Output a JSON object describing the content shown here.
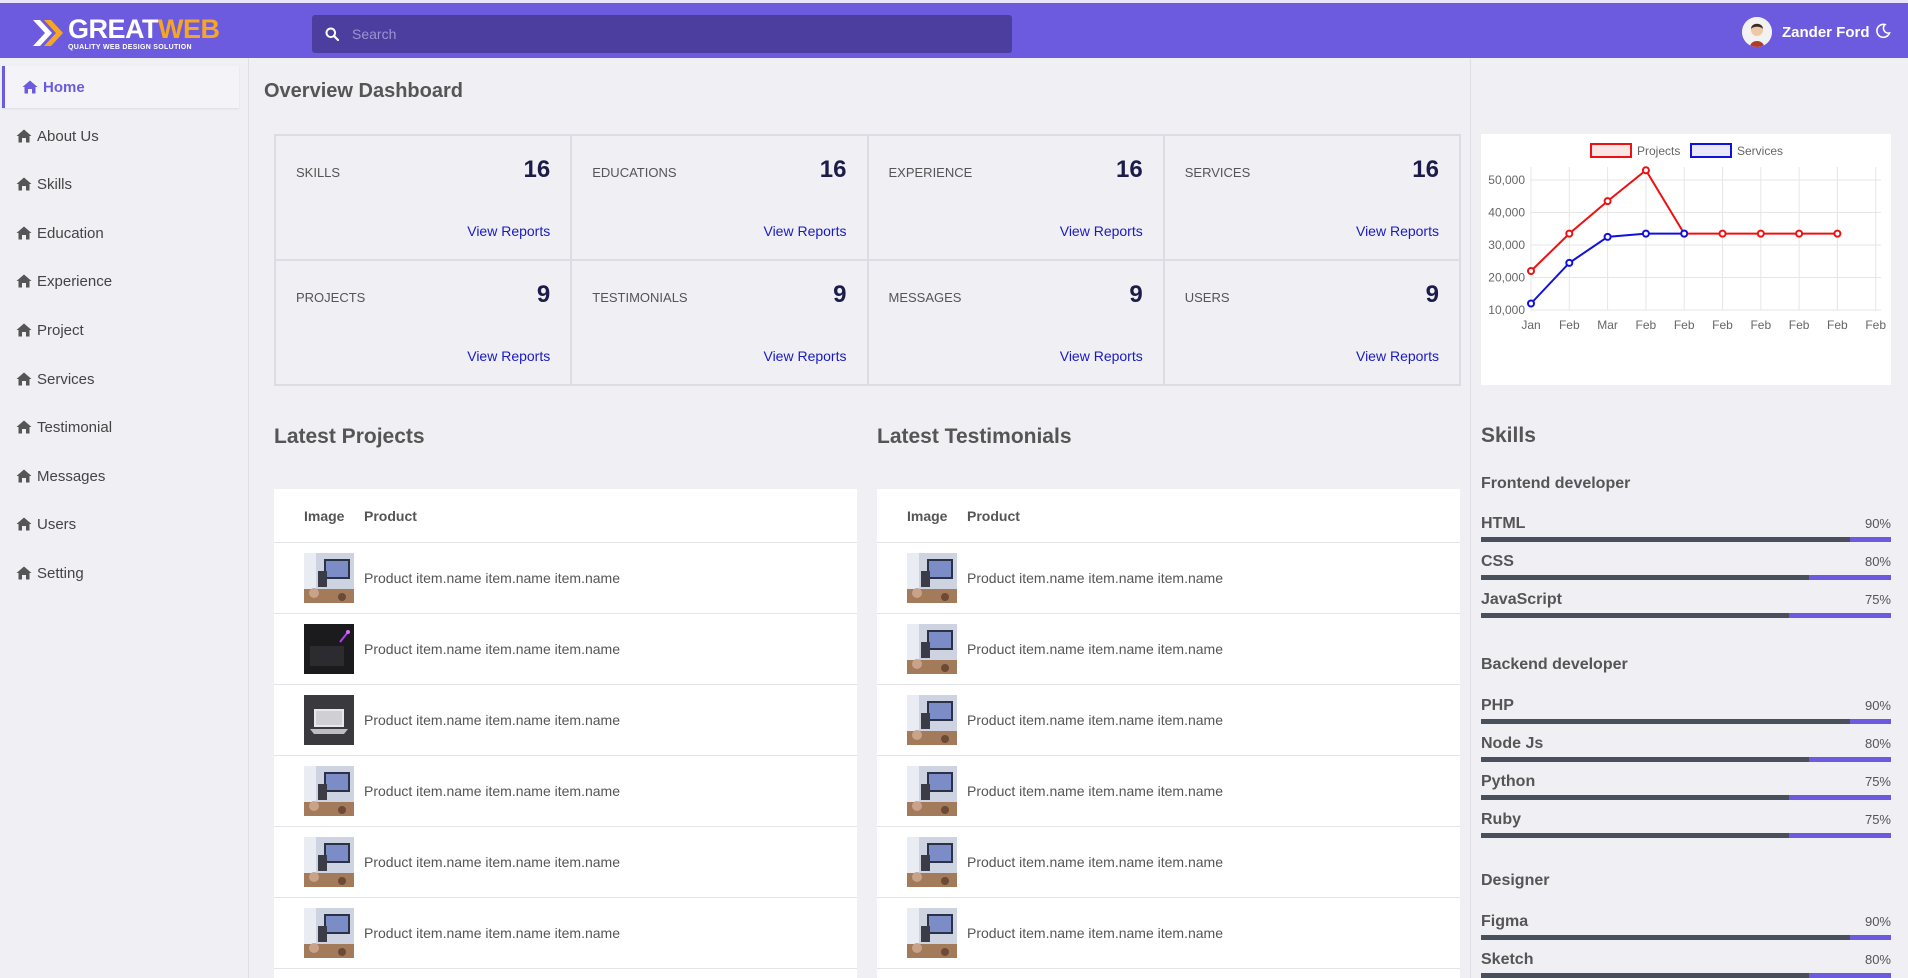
{
  "brand": {
    "name_part1": "GREAT",
    "name_part2": "WEB",
    "tagline": "QUALITY WEB DESIGN SOLUTION"
  },
  "search": {
    "placeholder": "Search"
  },
  "user": {
    "name": "Zander Ford"
  },
  "sidebar": {
    "items": [
      {
        "label": "Home",
        "active": true
      },
      {
        "label": "About Us"
      },
      {
        "label": "Skills"
      },
      {
        "label": "Education"
      },
      {
        "label": "Experience"
      },
      {
        "label": "Project"
      },
      {
        "label": "Services"
      },
      {
        "label": "Testimonial"
      },
      {
        "label": "Messages"
      },
      {
        "label": "Users"
      },
      {
        "label": "Setting"
      }
    ]
  },
  "page": {
    "title": "Overview Dashboard"
  },
  "cards": [
    {
      "label": "SKILLS",
      "value": "16",
      "link": "View Reports"
    },
    {
      "label": "EDUCATIONS",
      "value": "16",
      "link": "View Reports"
    },
    {
      "label": "EXPERIENCE",
      "value": "16",
      "link": "View Reports"
    },
    {
      "label": "SERVICES",
      "value": "16",
      "link": "View Reports"
    },
    {
      "label": "PROJECTS",
      "value": "9",
      "link": "View Reports"
    },
    {
      "label": "TESTIMONIALS",
      "value": "9",
      "link": "View Reports"
    },
    {
      "label": "MESSAGES",
      "value": "9",
      "link": "View Reports"
    },
    {
      "label": "USERS",
      "value": "9",
      "link": "View Reports"
    }
  ],
  "latest_projects": {
    "title": "Latest Projects",
    "columns": [
      "Image",
      "Product"
    ],
    "rows": [
      {
        "product": "Product item.name item.name item.name",
        "image": "desk-photo"
      },
      {
        "product": "Product item.name item.name item.name",
        "image": "dark-photo"
      },
      {
        "product": "Product item.name item.name item.name",
        "image": "laptop-photo"
      },
      {
        "product": "Product item.name item.name item.name",
        "image": "desk-photo"
      },
      {
        "product": "Product item.name item.name item.name",
        "image": "desk-photo"
      },
      {
        "product": "Product item.name item.name item.name",
        "image": "desk-photo"
      }
    ]
  },
  "latest_testimonials": {
    "title": "Latest Testimonials",
    "columns": [
      "Image",
      "Product"
    ],
    "rows": [
      {
        "product": "Product item.name item.name item.name",
        "image": "desk-photo"
      },
      {
        "product": "Product item.name item.name item.name",
        "image": "desk-photo"
      },
      {
        "product": "Product item.name item.name item.name",
        "image": "desk-photo"
      },
      {
        "product": "Product item.name item.name item.name",
        "image": "desk-photo"
      },
      {
        "product": "Product item.name item.name item.name",
        "image": "desk-photo"
      },
      {
        "product": "Product item.name item.name item.name",
        "image": "desk-photo"
      }
    ]
  },
  "chart_data": {
    "type": "line",
    "categories": [
      "Jan",
      "Feb",
      "Mar",
      "Feb",
      "Feb",
      "Feb",
      "Feb",
      "Feb",
      "Feb",
      "Feb"
    ],
    "series": [
      {
        "name": "Projects",
        "color": "#ee1111",
        "values": [
          22000,
          33500,
          43500,
          53000,
          33500,
          33500,
          33500,
          33500,
          33500
        ]
      },
      {
        "name": "Services",
        "color": "#1111dd",
        "values": [
          12000,
          24500,
          32500,
          33500,
          33500,
          null,
          null,
          null,
          null
        ]
      }
    ],
    "yticks": [
      "50,000",
      "40,000",
      "30,000",
      "20,000",
      "10,000"
    ],
    "ylim": [
      10000,
      50000
    ],
    "grid": true,
    "legend": "top"
  },
  "skills": {
    "title": "Skills",
    "groups": [
      {
        "title": "Frontend developer",
        "items": [
          {
            "name": "HTML",
            "pct": "90%",
            "value": 0.9
          },
          {
            "name": "CSS",
            "pct": "80%",
            "value": 0.8
          },
          {
            "name": "JavaScript",
            "pct": "75%",
            "value": 0.75
          }
        ]
      },
      {
        "title": "Backend developer",
        "items": [
          {
            "name": "PHP",
            "pct": "90%",
            "value": 0.9
          },
          {
            "name": "Node Js",
            "pct": "80%",
            "value": 0.8
          },
          {
            "name": "Python",
            "pct": "75%",
            "value": 0.75
          },
          {
            "name": "Ruby",
            "pct": "75%",
            "value": 0.75
          }
        ]
      },
      {
        "title": "Designer",
        "items": [
          {
            "name": "Figma",
            "pct": "90%",
            "value": 0.9
          },
          {
            "name": "Sketch",
            "pct": "80%",
            "value": 0.8
          }
        ]
      }
    ]
  },
  "colors": {
    "accent": "#6c5bdf",
    "link": "#1a1ac4",
    "bar_track": "#4a4f5c"
  }
}
